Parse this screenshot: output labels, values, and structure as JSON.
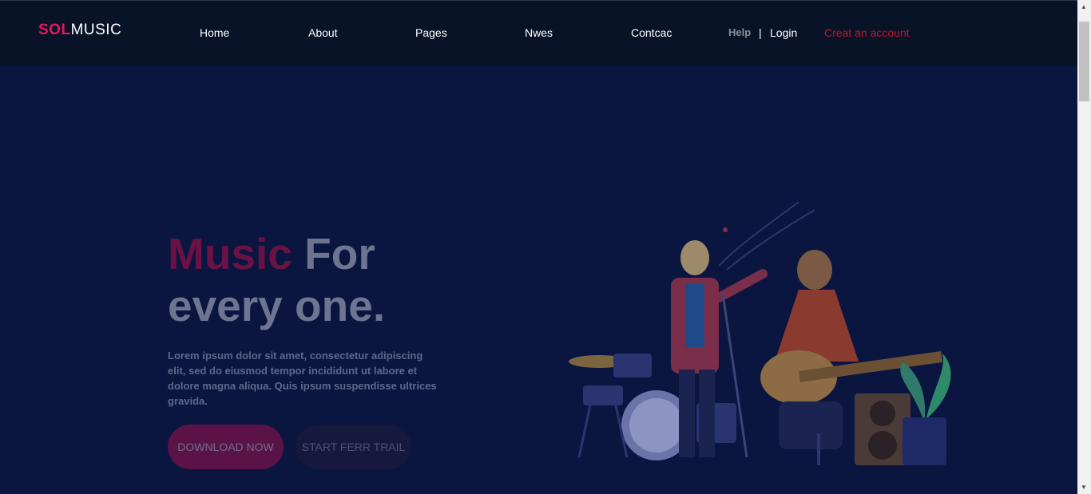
{
  "logo": {
    "sol": "SOL",
    "music": "MUSIC"
  },
  "nav": {
    "items": [
      {
        "label": "Home"
      },
      {
        "label": "About"
      },
      {
        "label": "Pages"
      },
      {
        "label": "Nwes"
      },
      {
        "label": "Contcac"
      }
    ],
    "help": "Help",
    "divider": "|",
    "login": "Login",
    "create_account": "Creat an account"
  },
  "hero": {
    "title_accent": "Music",
    "title_rest": " For",
    "title_line2": "every one.",
    "description": "Lorem ipsum dolor sit amet, consectetur adipiscing elit, sed do eiusmod tempor incididunt ut labore et dolore magna aliqua. Quis ipsum suspendisse ultrices gravida.",
    "download_label": "DOWNLOAD NOW",
    "trail_label": "START FERR TRAIL"
  },
  "scrollbar": {
    "up_icon": "▲",
    "down_icon": "▼"
  },
  "colors": {
    "accent": "#e6175c",
    "background": "#0a1640",
    "header": "#081328"
  }
}
